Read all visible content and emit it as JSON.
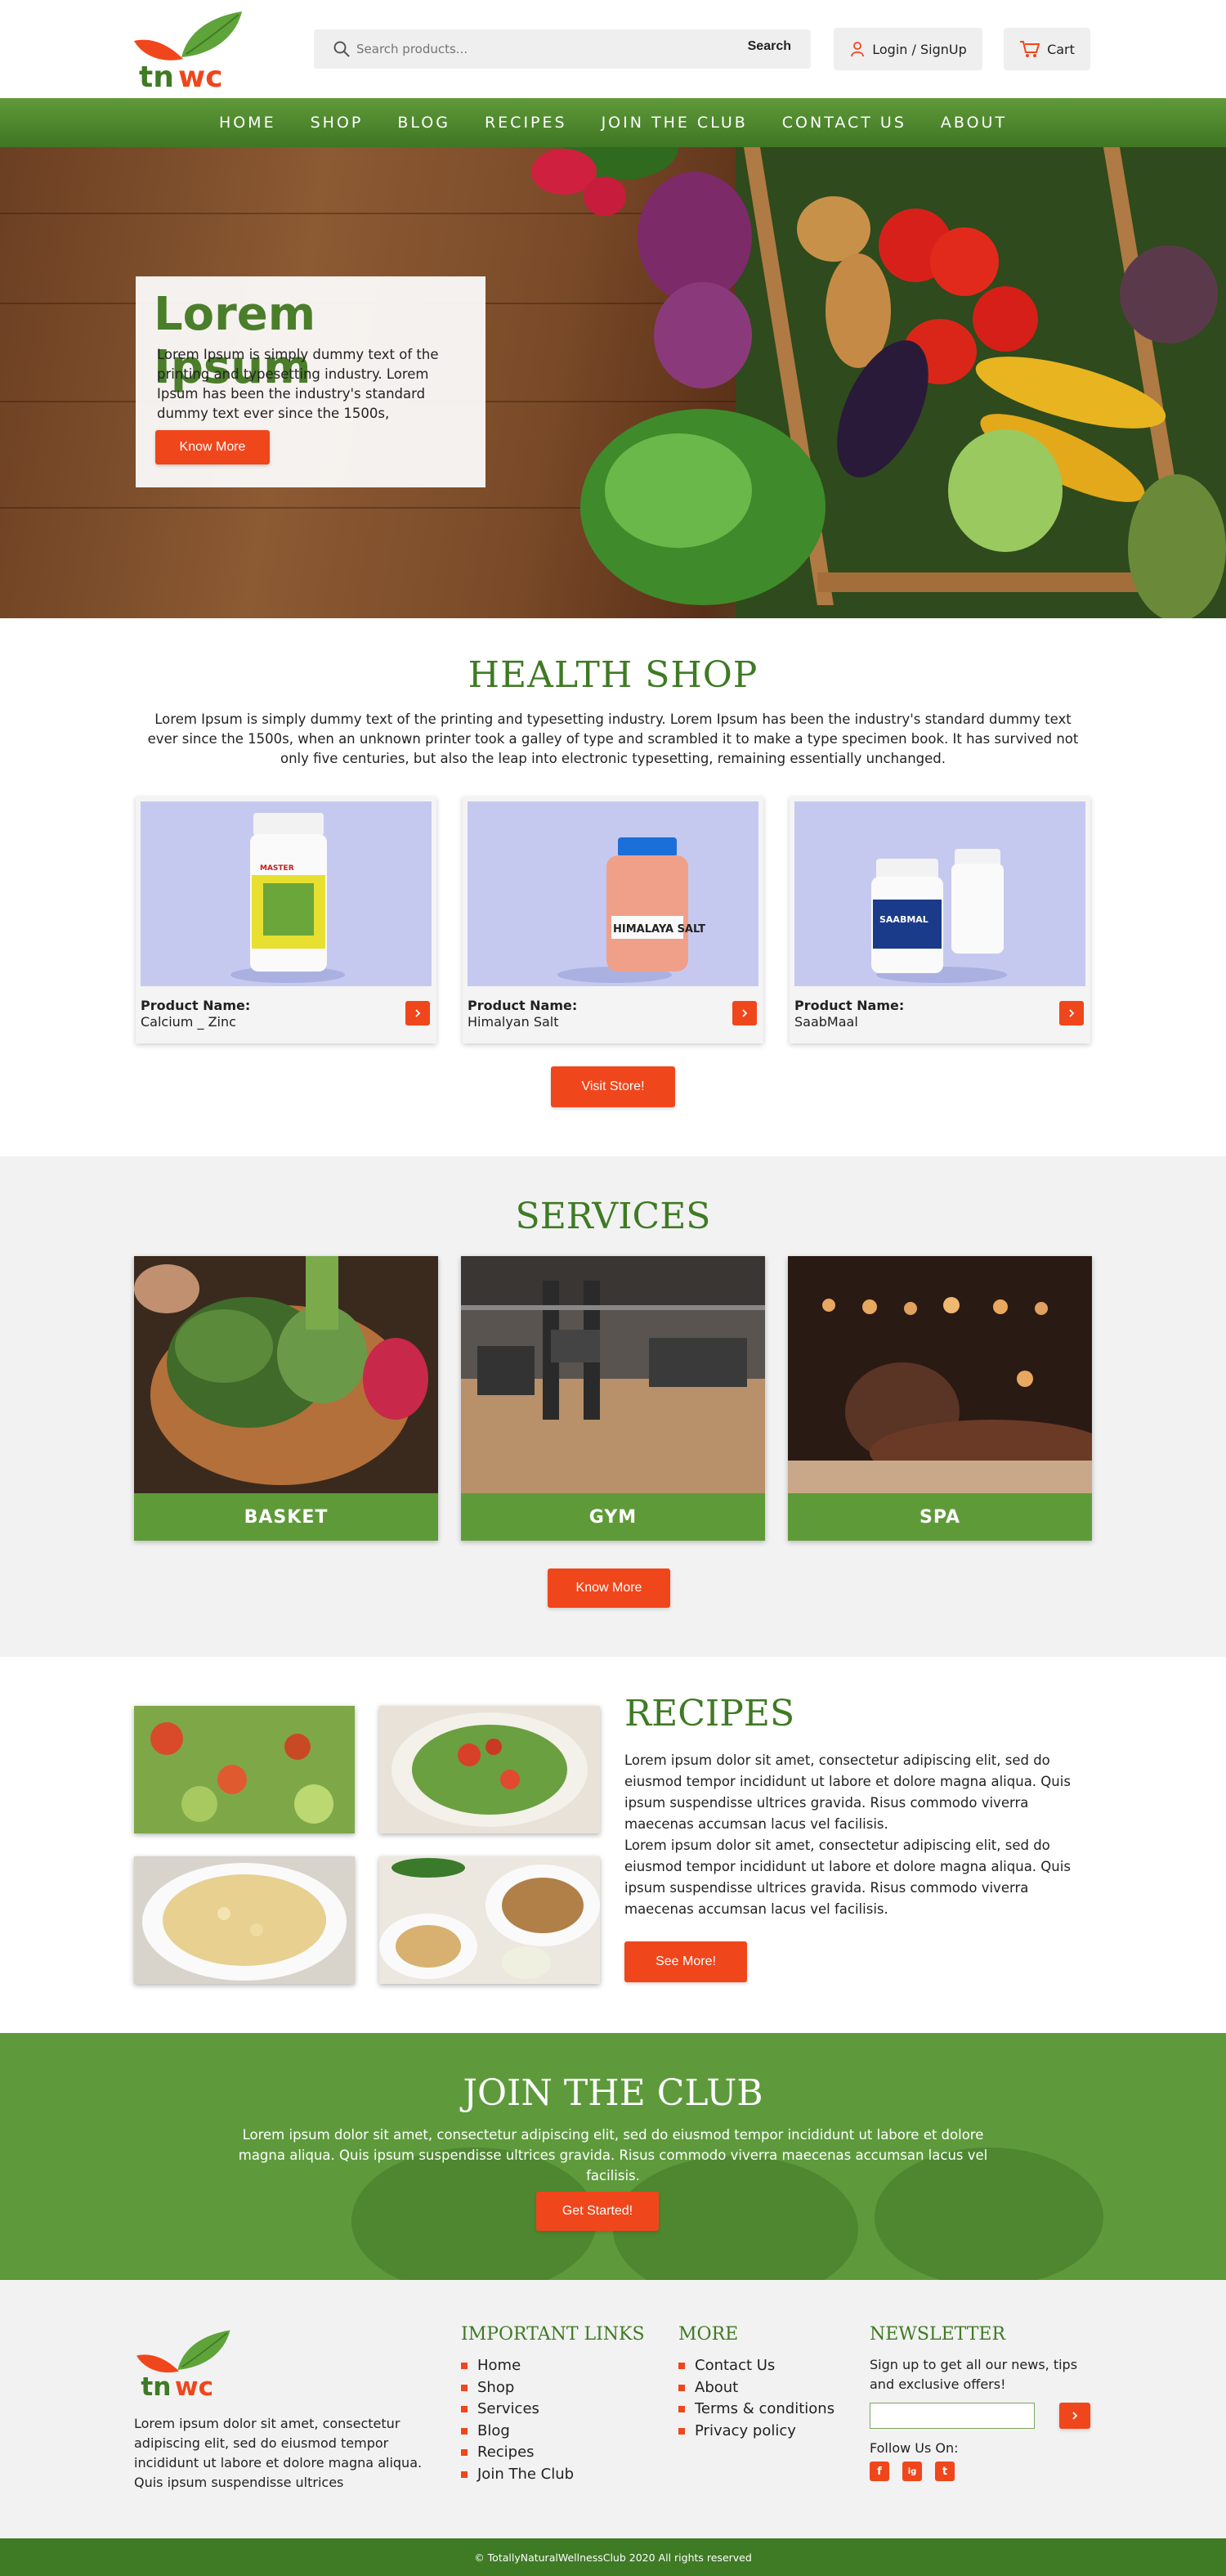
{
  "header": {
    "logo_text": "tnwc",
    "search_placeholder": "Search products...",
    "search_button": "Search",
    "login_label": "Login / SignUp",
    "cart_label": "Cart"
  },
  "nav": {
    "items": [
      "HOME",
      "SHOP",
      "BLOG",
      "RECIPES",
      "JOIN THE CLUB",
      "CONTACT US",
      "ABOUT"
    ]
  },
  "hero": {
    "title": "Lorem Ipsum",
    "text": "Lorem Ipsum is simply dummy text of the printing and typesetting industry. Lorem Ipsum has been the industry's standard dummy text ever since the 1500s,",
    "button": "Know More"
  },
  "health_shop": {
    "title": "HEALTH SHOP",
    "description": "Lorem Ipsum is simply dummy text of the printing and typesetting industry. Lorem Ipsum has been the industry's standard dummy text ever since the 1500s, when an unknown printer took a galley of type and scrambled it to make a type specimen book. It has survived not only five centuries, but also the leap into electronic typesetting, remaining essentially unchanged.",
    "product_label": "Product Name:",
    "products": [
      {
        "name": "Calcium _ Zinc",
        "jar_label": "MASTER"
      },
      {
        "name": "Himalyan Salt",
        "jar_label": "HIMALAYA SALT"
      },
      {
        "name": "SaabMaal",
        "jar_label": "SAABMAL"
      }
    ],
    "button": "Visit Store!"
  },
  "services": {
    "title": "SERVICES",
    "items": [
      "BASKET",
      "GYM",
      "SPA"
    ],
    "button": "Know More"
  },
  "recipes": {
    "title": "RECIPES",
    "paragraphs": [
      "Lorem ipsum dolor sit amet, consectetur adipiscing elit, sed do eiusmod tempor incididunt ut labore et dolore magna aliqua. Quis ipsum suspendisse ultrices gravida. Risus commodo viverra maecenas accumsan lacus vel facilisis.",
      "Lorem ipsum dolor sit amet, consectetur adipiscing elit, sed do eiusmod tempor incididunt ut labore et dolore magna aliqua. Quis ipsum suspendisse ultrices gravida. Risus commodo viverra maecenas accumsan lacus vel facilisis."
    ],
    "button": "See More!"
  },
  "join": {
    "title": "JOIN THE CLUB",
    "text": "Lorem ipsum dolor sit amet, consectetur adipiscing elit, sed do eiusmod tempor incididunt ut labore et dolore magna aliqua. Quis ipsum suspendisse ultrices gravida. Risus commodo viverra maecenas accumsan lacus vel facilisis.",
    "button": "Get Started!"
  },
  "footer": {
    "logo_text": "tnwc",
    "about": "Lorem ipsum dolor sit amet, consectetur adipiscing elit, sed do eiusmod tempor incididunt ut labore et dolore magna aliqua. Quis ipsum suspendisse ultrices",
    "important_links_title": "IMPORTANT LINKS",
    "important_links": [
      "Home",
      "Shop",
      "Services",
      "Blog",
      "Recipes",
      "Join The Club"
    ],
    "more_title": "MORE",
    "more_links": [
      "Contact Us",
      "About",
      "Terms & conditions",
      "Privacy policy"
    ],
    "newsletter_title": "NEWSLETTER",
    "newsletter_text": "Sign up to get all our news, tips and exclusive offers!",
    "follow_label": "Follow Us On:",
    "social": [
      "f",
      "ig",
      "t"
    ],
    "copyright": "© TotallyNaturalWellnessClub 2020 All rights reserved"
  },
  "colors": {
    "brand_green": "#3f7a24",
    "nav_green": "#5f9a39",
    "accent_orange": "#f0461c"
  }
}
